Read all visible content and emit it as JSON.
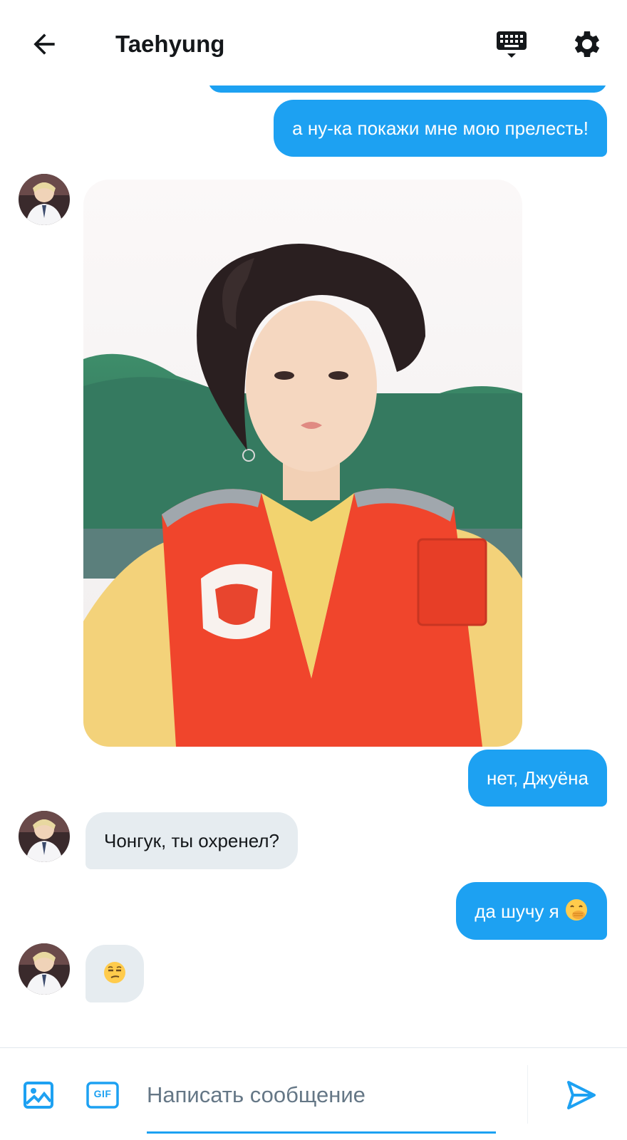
{
  "header": {
    "title": "Taehyung",
    "back_icon": "arrow-left-icon",
    "keyboard_icon": "keyboard-icon",
    "settings_icon": "gear-icon"
  },
  "messages": [
    {
      "side": "out",
      "text": "а ну-ка покажи мне мою прелесть!"
    },
    {
      "side": "in",
      "type": "image",
      "description_icon": "photo"
    },
    {
      "side": "out",
      "text": "нет, Джуёна"
    },
    {
      "side": "in",
      "text": "Чонгук, ты охренел?"
    },
    {
      "side": "out",
      "text": "да шучу я",
      "emoji": "hand-over-mouth-emoji"
    },
    {
      "side": "in",
      "emoji": "unamused-face-emoji"
    }
  ],
  "composer": {
    "placeholder": "Написать сообщение",
    "image_icon": "image-icon",
    "gif_label": "GIF",
    "send_icon": "send-icon"
  },
  "colors": {
    "accent": "#1da1f2",
    "incoming_bubble": "#e6ecf0",
    "text": "#14171a",
    "placeholder": "#657786"
  }
}
